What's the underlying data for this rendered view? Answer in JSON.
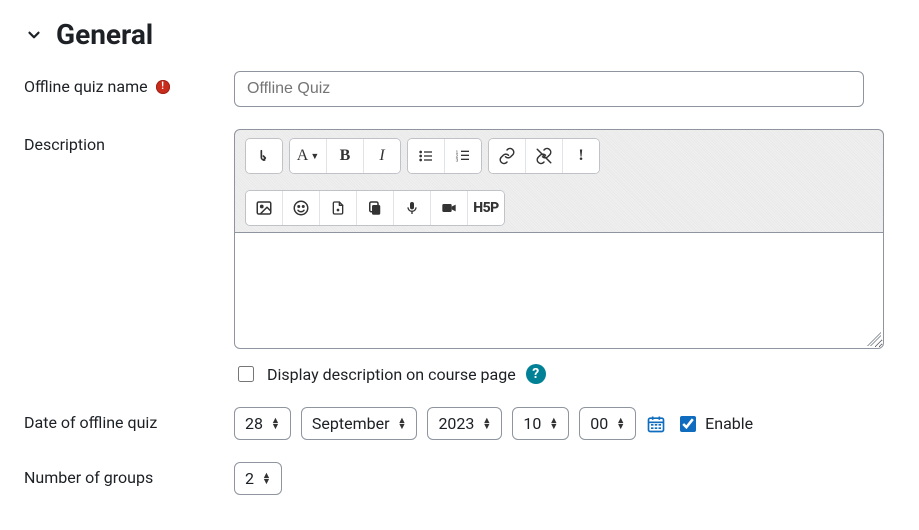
{
  "section": {
    "title": "General"
  },
  "fields": {
    "name": {
      "label": "Offline quiz name",
      "placeholder": "Offline Quiz",
      "value": ""
    },
    "description": {
      "label": "Description",
      "display_label": "Display description on course page",
      "display_checked": false
    },
    "date": {
      "label": "Date of offline quiz",
      "day": "28",
      "month": "September",
      "year": "2023",
      "hour": "10",
      "minute": "00",
      "enable_label": "Enable",
      "enable_checked": true
    },
    "groups": {
      "label": "Number of groups",
      "value": "2"
    }
  },
  "editor_toolbar": {
    "row1": [
      {
        "group": [
          "expand-toolbar"
        ]
      },
      {
        "group": [
          "paragraph-style",
          "bold",
          "italic"
        ]
      },
      {
        "group": [
          "bulleted-list",
          "numbered-list"
        ]
      },
      {
        "group": [
          "link",
          "unlink",
          "warning"
        ]
      }
    ],
    "row2": [
      {
        "group": [
          "image",
          "emoji",
          "file",
          "copy",
          "microphone",
          "video",
          "h5p"
        ]
      }
    ]
  },
  "icons": {
    "expand-toolbar": "↴",
    "bold": "B",
    "italic": "I",
    "warning": "!"
  }
}
